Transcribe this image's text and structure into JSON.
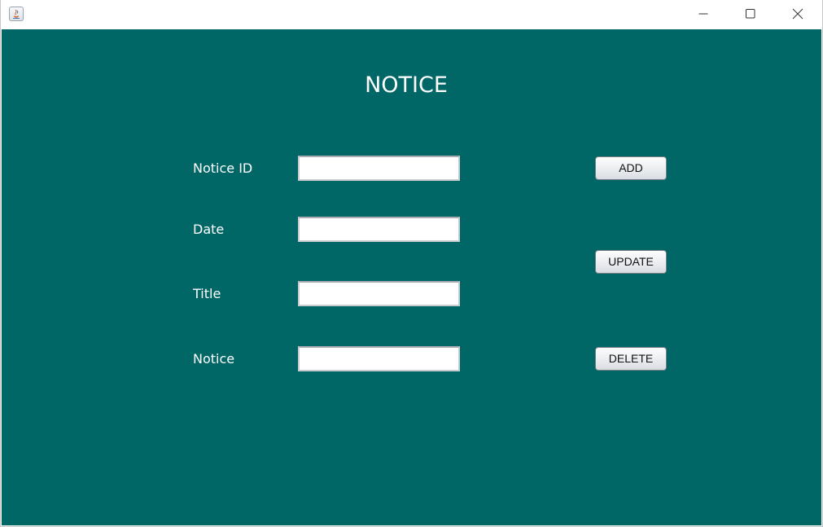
{
  "window": {
    "title": "",
    "controls": {
      "minimize_icon": "minimize-icon",
      "maximize_icon": "maximize-icon",
      "close_icon": "close-icon"
    }
  },
  "form": {
    "heading": "NOTICE",
    "fields": [
      {
        "label": "Notice ID",
        "value": ""
      },
      {
        "label": "Date",
        "value": ""
      },
      {
        "label": "Title",
        "value": ""
      },
      {
        "label": "Notice",
        "value": ""
      }
    ],
    "buttons": {
      "add": "ADD",
      "update": "UPDATE",
      "delete": "DELETE"
    }
  },
  "colors": {
    "background": "#006666",
    "text": "#ffffff"
  }
}
